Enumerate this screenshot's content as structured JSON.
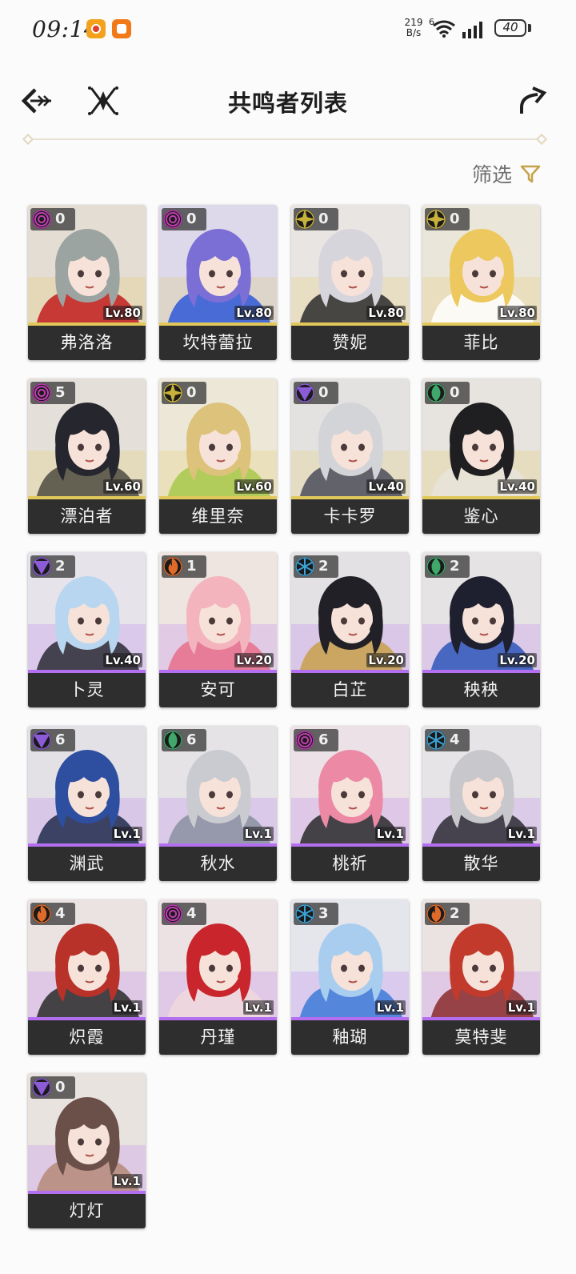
{
  "status_bar": {
    "time": "09:14",
    "net_speed_value": "219",
    "net_speed_unit": "B/s",
    "wifi_badge": "6",
    "battery": "40"
  },
  "header": {
    "title": "共鸣者列表"
  },
  "filter": {
    "label": "筛选"
  },
  "elements": {
    "aero": "#3fa86a",
    "havoc": "#c23db4",
    "spectro": "#c9b23a",
    "electro": "#8c5bd8",
    "fusion": "#e06a2a",
    "glacio": "#3aa3d8"
  },
  "resonators": [
    {
      "name": "弗洛洛",
      "level": "Lv.80",
      "seq": "0",
      "element": "havoc",
      "rarity": "5",
      "hair": "#9ca4a2",
      "bg": "#e4ddd4",
      "accent": "#c21d1d"
    },
    {
      "name": "坎特蕾拉",
      "level": "Lv.80",
      "seq": "0",
      "element": "havoc",
      "rarity": "5",
      "hair": "#7b6fd6",
      "bg": "#ddd9ea",
      "accent": "#2f58d8"
    },
    {
      "name": "赞妮",
      "level": "Lv.80",
      "seq": "0",
      "element": "spectro",
      "rarity": "5",
      "hair": "#d7d5dc",
      "bg": "#e8e5e2",
      "accent": "#2b2b2b"
    },
    {
      "name": "菲比",
      "level": "Lv.80",
      "seq": "0",
      "element": "spectro",
      "rarity": "5",
      "hair": "#ecc85e",
      "bg": "#ebe6da",
      "accent": "#ffffff"
    },
    {
      "name": "漂泊者",
      "level": "Lv.60",
      "seq": "5",
      "element": "havoc",
      "rarity": "5",
      "hair": "#26262e",
      "bg": "#e4dfd8",
      "accent": "#4d4a40"
    },
    {
      "name": "维里奈",
      "level": "Lv.60",
      "seq": "0",
      "element": "spectro",
      "rarity": "5",
      "hair": "#dcc27a",
      "bg": "#ece7d6",
      "accent": "#a8c84a"
    },
    {
      "name": "卡卡罗",
      "level": "Lv.40",
      "seq": "0",
      "element": "electro",
      "rarity": "5",
      "hair": "#d2d4d8",
      "bg": "#e4e2e0",
      "accent": "#4b4e5a"
    },
    {
      "name": "鉴心",
      "level": "Lv.40",
      "seq": "0",
      "element": "aero",
      "rarity": "5",
      "hair": "#1f1f22",
      "bg": "#e7e3de",
      "accent": "#e8e4da"
    },
    {
      "name": "卜灵",
      "level": "Lv.40",
      "seq": "2",
      "element": "electro",
      "rarity": "4",
      "hair": "#b8d6ef",
      "bg": "#e6e3ea",
      "accent": "#2a2a34"
    },
    {
      "name": "安可",
      "level": "Lv.20",
      "seq": "1",
      "element": "fusion",
      "rarity": "4",
      "hair": "#f3b4be",
      "bg": "#eee4e0",
      "accent": "#e66e8a"
    },
    {
      "name": "白芷",
      "level": "Lv.20",
      "seq": "2",
      "element": "glacio",
      "rarity": "4",
      "hair": "#202026",
      "bg": "#e4e1e5",
      "accent": "#c8a04a"
    },
    {
      "name": "秧秧",
      "level": "Lv.20",
      "seq": "2",
      "element": "aero",
      "rarity": "4",
      "hair": "#1e2030",
      "bg": "#e6e3e4",
      "accent": "#2e56b8"
    },
    {
      "name": "渊武",
      "level": "Lv.1",
      "seq": "6",
      "element": "electro",
      "rarity": "4",
      "hair": "#2e4fa0",
      "bg": "#e3e1e6",
      "accent": "#1f2a4c"
    },
    {
      "name": "秋水",
      "level": "Lv.1",
      "seq": "6",
      "element": "aero",
      "rarity": "4",
      "hair": "#c9cbd0",
      "bg": "#e5e3e6",
      "accent": "#8a8fa0"
    },
    {
      "name": "桃祈",
      "level": "Lv.1",
      "seq": "6",
      "element": "havoc",
      "rarity": "4",
      "hair": "#ec8aa6",
      "bg": "#ebe1e6",
      "accent": "#2a2a2a"
    },
    {
      "name": "散华",
      "level": "Lv.1",
      "seq": "4",
      "element": "glacio",
      "rarity": "4",
      "hair": "#c8c8cc",
      "bg": "#e6e4e6",
      "accent": "#2c2c34"
    },
    {
      "name": "炽霞",
      "level": "Lv.1",
      "seq": "4",
      "element": "fusion",
      "rarity": "4",
      "hair": "#b8322a",
      "bg": "#ebe2e2",
      "accent": "#2a2a2a"
    },
    {
      "name": "丹瑾",
      "level": "Lv.1",
      "seq": "4",
      "element": "havoc",
      "rarity": "4",
      "hair": "#c8262c",
      "bg": "#ece2e4",
      "accent": "#f0d8dc"
    },
    {
      "name": "釉瑚",
      "level": "Lv.1",
      "seq": "3",
      "element": "glacio",
      "rarity": "4",
      "hair": "#a9cdef",
      "bg": "#e5e5ec",
      "accent": "#3c7ad8"
    },
    {
      "name": "莫特斐",
      "level": "Lv.1",
      "seq": "2",
      "element": "fusion",
      "rarity": "4",
      "hair": "#c23a2c",
      "bg": "#ebe3e2",
      "accent": "#8a2a2a"
    },
    {
      "name": "灯灯",
      "level": "Lv.1",
      "seq": "0",
      "element": "electro",
      "rarity": "4",
      "hair": "#6a5048",
      "bg": "#e9e3e0",
      "accent": "#b58a78"
    }
  ],
  "rarity_colors": {
    "5": "#e2c85a",
    "4": "#b46ff0"
  }
}
